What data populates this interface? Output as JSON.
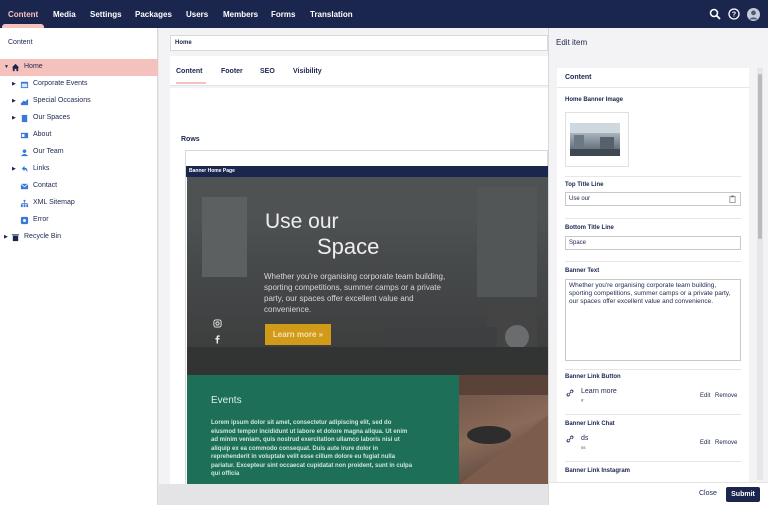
{
  "top_nav": {
    "items": [
      "Content",
      "Media",
      "Settings",
      "Packages",
      "Users",
      "Members",
      "Forms",
      "Translation"
    ],
    "active": "Content",
    "icons": [
      "search-icon",
      "help-icon",
      "user-avatar"
    ]
  },
  "sidebar": {
    "title": "Content",
    "tree": [
      {
        "label": "Home",
        "icon": "home-icon",
        "expanded": true,
        "selected": true
      },
      {
        "label": "Corporate Events",
        "icon": "calendar-icon"
      },
      {
        "label": "Special Occasions",
        "icon": "chart-icon"
      },
      {
        "label": "Our Spaces",
        "icon": "building-icon"
      },
      {
        "label": "About",
        "icon": "card-icon"
      },
      {
        "label": "Our Team",
        "icon": "team-icon"
      },
      {
        "label": "Links",
        "icon": "link-arrow-icon"
      },
      {
        "label": "Contact",
        "icon": "mail-icon"
      },
      {
        "label": "XML Sitemap",
        "icon": "sitemap-icon"
      },
      {
        "label": "Error",
        "icon": "error-icon"
      },
      {
        "label": "Recycle Bin",
        "icon": "trash-icon"
      }
    ]
  },
  "editor": {
    "node_name": "Home",
    "tabs": [
      "Content",
      "Footer",
      "SEO",
      "Visibility"
    ],
    "active_tab": "Content",
    "rows_label": "Rows",
    "banner": {
      "header": "Banner Home Page",
      "title_line1": "Use our",
      "title_line2": "Space",
      "text": "Whether you're organising corporate team building, sporting competitions, summer camps or a private party, our spaces offer excellent value and convenience.",
      "button": "Learn more »",
      "social": [
        "instagram-icon",
        "facebook-icon"
      ]
    },
    "events": {
      "title": "Events",
      "text": "Lorem ipsum dolor sit amet, consectetur adipiscing elit, sed do eiusmod tempor incididunt ut labore et dolore magna aliqua. Ut enim ad minim veniam, quis nostrud exercitation ullamco laboris nisi ut aliquip ex ea commodo consequat. Duis aute irure dolor in reprehenderit in voluptate velit esse cillum dolore eu fugiat nulla pariatur. Excepteur sint occaecat cupidatat non proident, sunt in culpa qui officia"
    }
  },
  "edit_panel": {
    "title": "Edit item",
    "card_title": "Content",
    "home_banner_image_label": "Home Banner Image",
    "top_title_label": "Top Title Line",
    "top_title_value": "Use our",
    "bottom_title_label": "Bottom Title Line",
    "bottom_title_value": "Space",
    "banner_text_label": "Banner Text",
    "banner_text_value": "Whether you're organising corporate team building, sporting competitions, summer camps or a private party, our spaces offer excellent value and convenience.",
    "link_button_label": "Banner Link Button",
    "link_button_name": "Learn more",
    "link_button_url": "#",
    "link_chat_label": "Banner Link Chat",
    "link_chat_name": "ds",
    "link_chat_url": "ss",
    "link_instagram_label": "Banner Link Instagram",
    "edit_label": "Edit",
    "remove_label": "Remove",
    "close_label": "Close",
    "submit_label": "Submit"
  },
  "colors": {
    "nav_bg": "#1b264f",
    "accent": "#f5c1bc",
    "banner_button": "#d19a19",
    "events_bg": "#1d6f57"
  }
}
